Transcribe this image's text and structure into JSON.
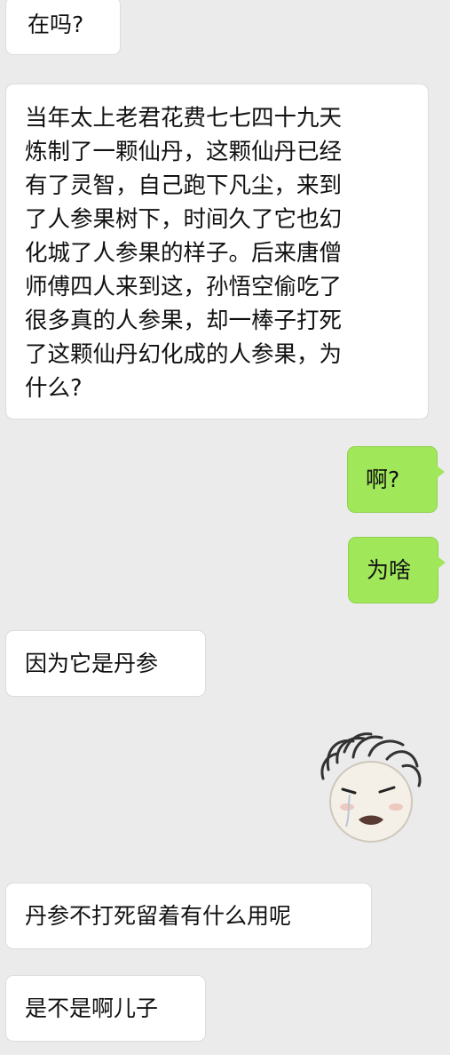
{
  "chat": {
    "messages": [
      {
        "side": "left",
        "text": "在吗?"
      },
      {
        "side": "left",
        "text": "当年太上老君花费七七四十九天\n炼制了一颗仙丹，这颗仙丹已经\n有了灵智，自己跑下凡尘，来到\n了人参果树下，时间久了它也幻\n化城了人参果的样子。后来唐僧\n师傅四人来到这，孙悟空偷吃了\n很多真的人参果，却一棒子打死\n了这颗仙丹幻化成的人参果，为\n什么?"
      },
      {
        "side": "right",
        "text": "啊?"
      },
      {
        "side": "right",
        "text": "为啥"
      },
      {
        "side": "left",
        "text": "因为它是丹参"
      },
      {
        "side": "right",
        "sticker": "crying-face-sticker"
      },
      {
        "side": "left",
        "text": "丹参不打死留着有什么用呢"
      },
      {
        "side": "left",
        "text": "是不是啊儿子"
      }
    ]
  },
  "colors": {
    "background": "#ebebeb",
    "incoming_bubble": "#ffffff",
    "outgoing_bubble": "#a0e75a",
    "text": "#111111"
  }
}
